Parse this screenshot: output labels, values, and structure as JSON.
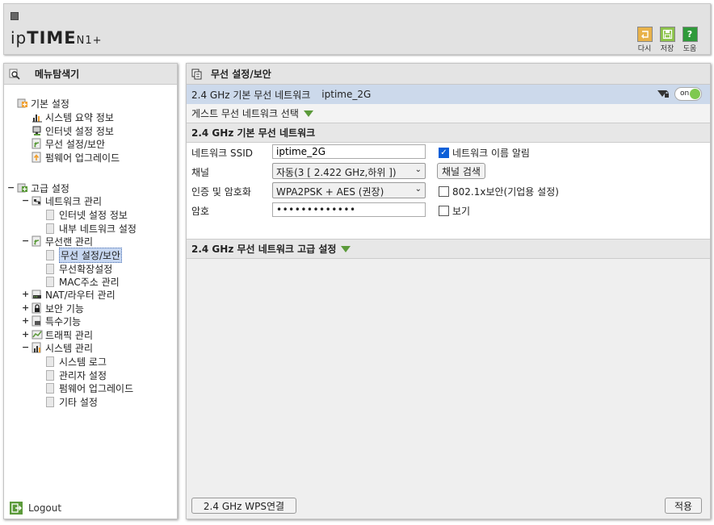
{
  "header": {
    "logo_prefix": "ip",
    "logo_bold": "TIME",
    "logo_model": "N1+",
    "tools": [
      {
        "label": "다시",
        "color": "#e8b24a",
        "icon": "undo-icon"
      },
      {
        "label": "저장",
        "color": "#8cc34a",
        "icon": "save-icon"
      },
      {
        "label": "도움",
        "color": "#2f9a3a",
        "icon": "help-icon",
        "glyph": "?"
      }
    ]
  },
  "left": {
    "title": "메뉴탐색기",
    "logout": "Logout",
    "basic": {
      "label": "기본 설정",
      "items": [
        "시스템 요약 정보",
        "인터넷 설정 정보",
        "무선 설정/보안",
        "펌웨어 업그레이드"
      ]
    },
    "advanced": {
      "label": "고급 설정",
      "expander": "−",
      "network": {
        "label": "네트워크 관리",
        "expander": "−",
        "items": [
          "인터넷 설정 정보",
          "내부 네트워크 설정"
        ]
      },
      "wireless": {
        "label": "무선랜 관리",
        "expander": "−",
        "items": [
          "무선 설정/보안",
          "무선확장설정",
          "MAC주소 관리"
        ]
      },
      "nat": {
        "label": "NAT/라우터 관리",
        "expander": "+"
      },
      "security": {
        "label": "보안 기능",
        "expander": "+"
      },
      "special": {
        "label": "특수기능",
        "expander": "+"
      },
      "traffic": {
        "label": "트래픽 관리",
        "expander": "+"
      },
      "system": {
        "label": "시스템 관리",
        "expander": "−",
        "items": [
          "시스템 로그",
          "관리자 설정",
          "펌웨어 업그레이드",
          "기타 설정"
        ]
      }
    }
  },
  "right": {
    "title": "무선 설정/보안",
    "band_label": "2.4 GHz 기본 무선 네트워크",
    "band_ssid": "iptime_2G",
    "toggle_label": "on",
    "guest_label": "게스트 무선 네트워크 선택",
    "basic_section": "2.4 GHz 기본 무선 네트워크",
    "form": {
      "ssid_label": "네트워크 SSID",
      "ssid_value": "iptime_2G",
      "broadcast_label": "네트워크 이름 알림",
      "channel_label": "채널",
      "channel_value": "자동(3 [ 2.422 GHz,하위 ])",
      "channel_search": "채널 검색",
      "auth_label": "인증 및 암호화",
      "auth_value": "WPA2PSK + AES (권장)",
      "enterprise_label": "802.1x보안(기업용 설정)",
      "password_label": "암호",
      "password_value": "•••••••••••••",
      "show_label": "보기"
    },
    "advanced_section": "2.4 GHz 무선 네트워크 고급 설정",
    "wps_button": "2.4 GHz WPS연결",
    "apply_button": "적용"
  }
}
